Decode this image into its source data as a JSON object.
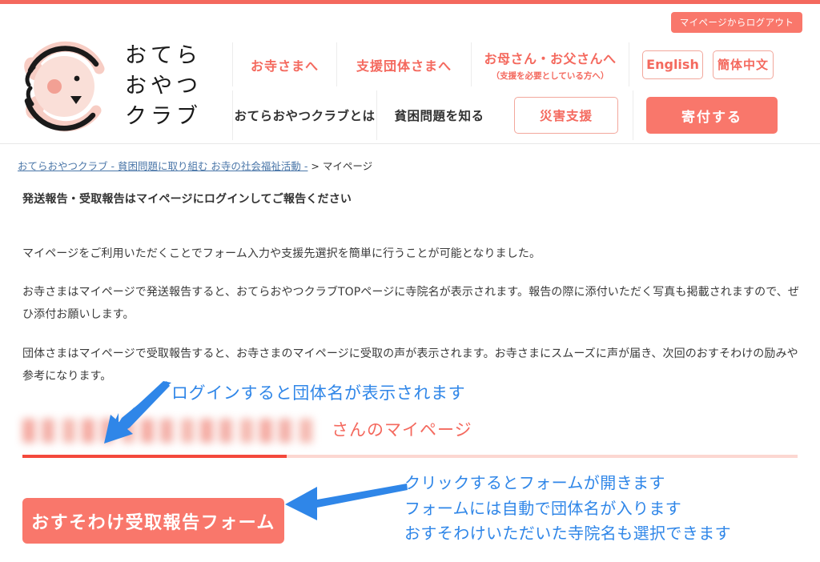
{
  "site": {
    "logo_text": "おてら\nおやつ\nクラブ",
    "logo_icon": "otera-oyatsu-club-logo-icon"
  },
  "header": {
    "logout_label": "マイページからログアウト",
    "nav_upper": [
      {
        "label": "お寺さまへ"
      },
      {
        "label": "支援団体さまへ"
      },
      {
        "label": "お母さん・お父さんへ",
        "sublabel": "（支援を必要としている方へ）"
      }
    ],
    "lang": {
      "english": "English",
      "chinese": "簡体中文"
    },
    "nav_lower": [
      {
        "label": "おてらおやつクラブとは"
      },
      {
        "label": "貧困問題を知る"
      }
    ],
    "disaster_label": "災害支援",
    "donate_label": "寄付する"
  },
  "breadcrumb": {
    "home_label": "おてらおやつクラブ - 貧困問題に取り組む お寺の社会福祉活動 -",
    "separator": " > ",
    "current": "マイページ"
  },
  "main": {
    "lead": "発送報告・受取報告はマイページにログインしてご報告ください",
    "paragraph_1": "マイページをご利用いただくことでフォーム入力や支援先選択を簡単に行うことが可能となりました。",
    "paragraph_2": "お寺さまはマイページで発送報告すると、おてらおやつクラブTOPページに寺院名が表示されます。報告の際に添付いただく写真も掲載されますので、ぜひ添付お願いします。",
    "paragraph_3": "団体さまはマイページで受取報告すると、お寺さまのマイページに受取の声が表示されます。お寺さまにスムーズに声が届き、次回のおすそわけの励みや参考になります。",
    "mypage_name_redacted": "",
    "mypage_suffix": "さんのマイページ",
    "cta_label": "おすそわけ受取報告フォーム"
  },
  "annotations": {
    "note_1": "ログインすると団体名が表示されます",
    "note_2_line_1": "クリックするとフォームが開きます",
    "note_2_line_2": "フォームには自動で団体名が入ります",
    "note_2_line_3": "おすそわけいただいた寺院名も選択できます",
    "arrow_1_icon": "arrow-down-left-icon",
    "arrow_2_icon": "arrow-left-icon"
  },
  "colors": {
    "brand_coral": "#f9776b",
    "brand_coral_dark": "#f4695e",
    "annotation_blue": "#2f86e8",
    "link_blue": "#4a76a8",
    "divider_light": "#fcd7d1",
    "divider_fill": "#f4493c"
  }
}
